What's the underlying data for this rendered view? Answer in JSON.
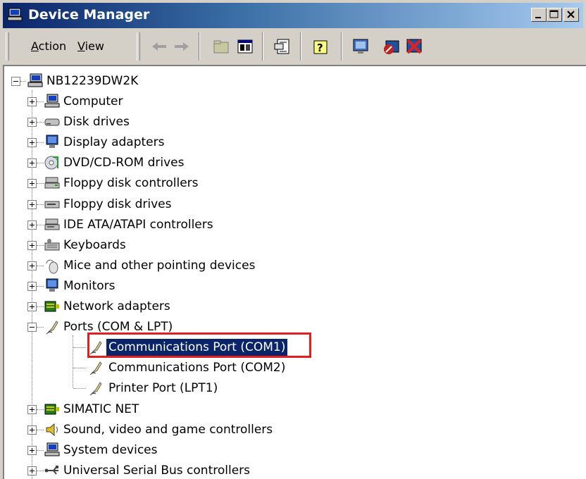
{
  "window": {
    "title": "Device Manager",
    "controls": [
      "minimize",
      "maximize",
      "close"
    ]
  },
  "toolbar": {
    "menus": [
      {
        "label": "Action",
        "accel": "A",
        "rest": "ction"
      },
      {
        "label": "View",
        "accel": "V",
        "rest": "iew"
      }
    ],
    "buttons": [
      "back-icon",
      "forward-icon",
      "up-folder-icon",
      "properties-pane-icon",
      "properties-icon",
      "help-icon",
      "scan-hardware-icon",
      "disable-device-icon",
      "uninstall-device-icon"
    ]
  },
  "tree": {
    "root": "NB12239DW2K",
    "categories": [
      {
        "label": "Computer",
        "icon": "computer-icon",
        "expanded": false
      },
      {
        "label": "Disk drives",
        "icon": "disk-drive-icon",
        "expanded": false
      },
      {
        "label": "Display adapters",
        "icon": "display-adapter-icon",
        "expanded": false
      },
      {
        "label": "DVD/CD-ROM drives",
        "icon": "dvd-drive-icon",
        "expanded": false
      },
      {
        "label": "Floppy disk controllers",
        "icon": "floppy-controller-icon",
        "expanded": false
      },
      {
        "label": "Floppy disk drives",
        "icon": "floppy-drive-icon",
        "expanded": false
      },
      {
        "label": "IDE ATA/ATAPI controllers",
        "icon": "ide-controller-icon",
        "expanded": false
      },
      {
        "label": "Keyboards",
        "icon": "keyboard-icon",
        "expanded": false
      },
      {
        "label": "Mice and other pointing devices",
        "icon": "mouse-icon",
        "expanded": false
      },
      {
        "label": "Monitors",
        "icon": "monitor-icon",
        "expanded": false
      },
      {
        "label": "Network adapters",
        "icon": "network-adapter-icon",
        "expanded": false
      },
      {
        "label": "Ports (COM & LPT)",
        "icon": "port-icon",
        "expanded": true,
        "children": [
          {
            "label": "Communications Port (COM1)",
            "selected": true
          },
          {
            "label": "Communications Port (COM2)",
            "selected": false
          },
          {
            "label": "Printer Port (LPT1)",
            "selected": false
          }
        ]
      },
      {
        "label": "SIMATIC NET",
        "icon": "simatic-net-icon",
        "expanded": false
      },
      {
        "label": "Sound, video and game controllers",
        "icon": "sound-icon",
        "expanded": false
      },
      {
        "label": "System devices",
        "icon": "system-devices-icon",
        "expanded": false
      },
      {
        "label": "Universal Serial Bus controllers",
        "icon": "usb-icon",
        "expanded": false
      }
    ]
  },
  "colors": {
    "selection": "#0a246a",
    "highlight_box": "#e02020",
    "titlebar_start": "#0a246a",
    "titlebar_end": "#a6caf0"
  }
}
